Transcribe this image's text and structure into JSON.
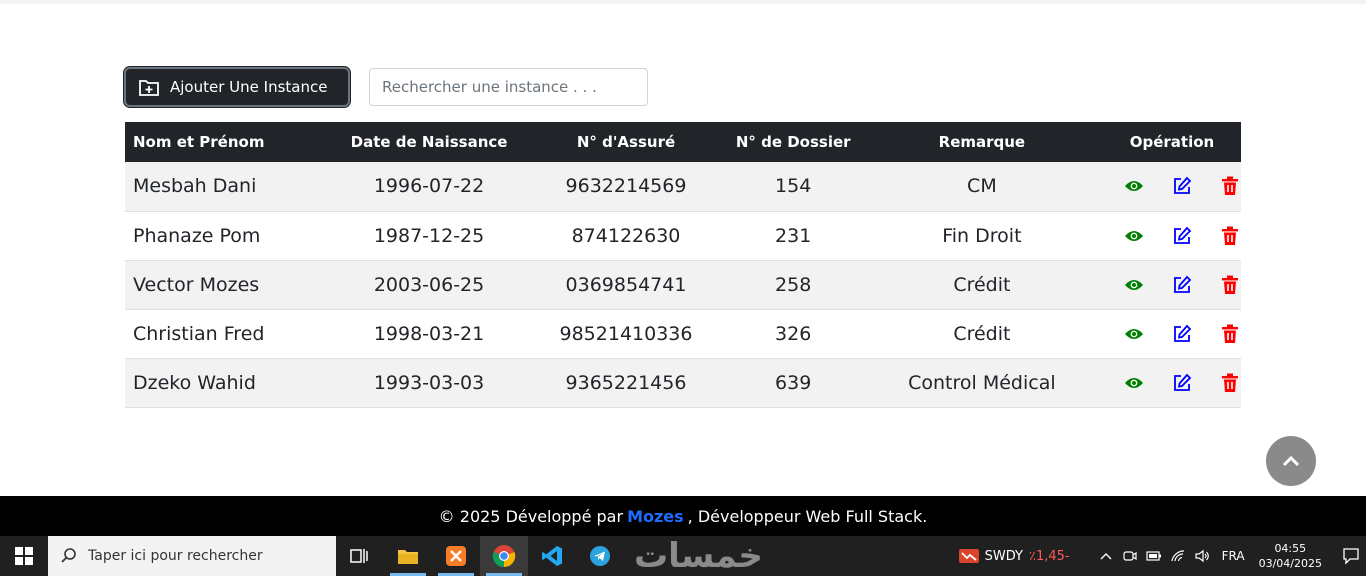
{
  "toolbar": {
    "add_label": "Ajouter Une Instance",
    "search_placeholder": "Rechercher une instance . . ."
  },
  "table": {
    "headers": [
      "Nom et Prénom",
      "Date de Naissance",
      "N° d'Assuré",
      "N° de Dossier",
      "Remarque",
      "Opération"
    ],
    "rows": [
      {
        "name": "Mesbah Dani",
        "dob": "1996-07-22",
        "insured": "9632214569",
        "file": "154",
        "remark": "CM"
      },
      {
        "name": "Phanaze Pom",
        "dob": "1987-12-25",
        "insured": "874122630",
        "file": "231",
        "remark": "Fin Droit"
      },
      {
        "name": "Vector Mozes",
        "dob": "2003-06-25",
        "insured": "0369854741",
        "file": "258",
        "remark": "Crédit"
      },
      {
        "name": "Christian Fred",
        "dob": "1998-03-21",
        "insured": "98521410336",
        "file": "326",
        "remark": "Crédit"
      },
      {
        "name": "Dzeko Wahid",
        "dob": "1993-03-03",
        "insured": "9365221456",
        "file": "639",
        "remark": "Control Médical"
      }
    ],
    "op_icons": {
      "view": "eye-icon",
      "edit": "edit-icon",
      "delete": "trash-icon"
    },
    "colors": {
      "view": "#008000",
      "edit": "#0000ff",
      "delete": "#ff0000",
      "header_bg": "#212529"
    }
  },
  "footer": {
    "prefix": "© 2025 Développé par",
    "author": "Mozes",
    "suffix": ", Développeur Web Full Stack."
  },
  "taskbar": {
    "search_placeholder": "Taper ici pour rechercher",
    "watermark": "خمسات",
    "stock_symbol": "SWDY",
    "stock_change": "٪1,45-",
    "language": "FRA",
    "time": "04:55",
    "date": "03/04/2025"
  }
}
